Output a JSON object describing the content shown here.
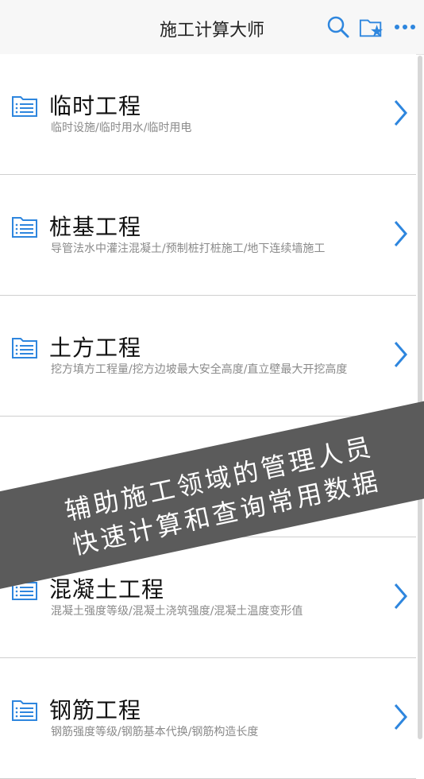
{
  "navbar": {
    "title": "施工计算大师",
    "icons": [
      "search-icon",
      "folder-star-icon",
      "more-icon"
    ],
    "accent": "#2e86de"
  },
  "list": [
    {
      "title": "临时工程",
      "subtitle": "临时设施/临时用水/临时用电"
    },
    {
      "title": "桩基工程",
      "subtitle": "导管法水中灌注混凝土/预制桩打桩施工/地下连续墙施工"
    },
    {
      "title": "土方工程",
      "subtitle": "挖方填方工程量/挖方边坡最大安全高度/直立壁最大开挖高度"
    },
    {
      "title": "",
      "subtitle": ""
    },
    {
      "title": "混凝土工程",
      "subtitle": "混凝土强度等级/混凝土浇筑强度/混凝土温度变形值"
    },
    {
      "title": "钢筋工程",
      "subtitle": "钢筋强度等级/钢筋基本代换/钢筋构造长度"
    }
  ],
  "banner": {
    "line1": "辅助施工领域的管理人员",
    "line2": "快速计算和查询常用数据",
    "background": "#5b5b5b"
  }
}
